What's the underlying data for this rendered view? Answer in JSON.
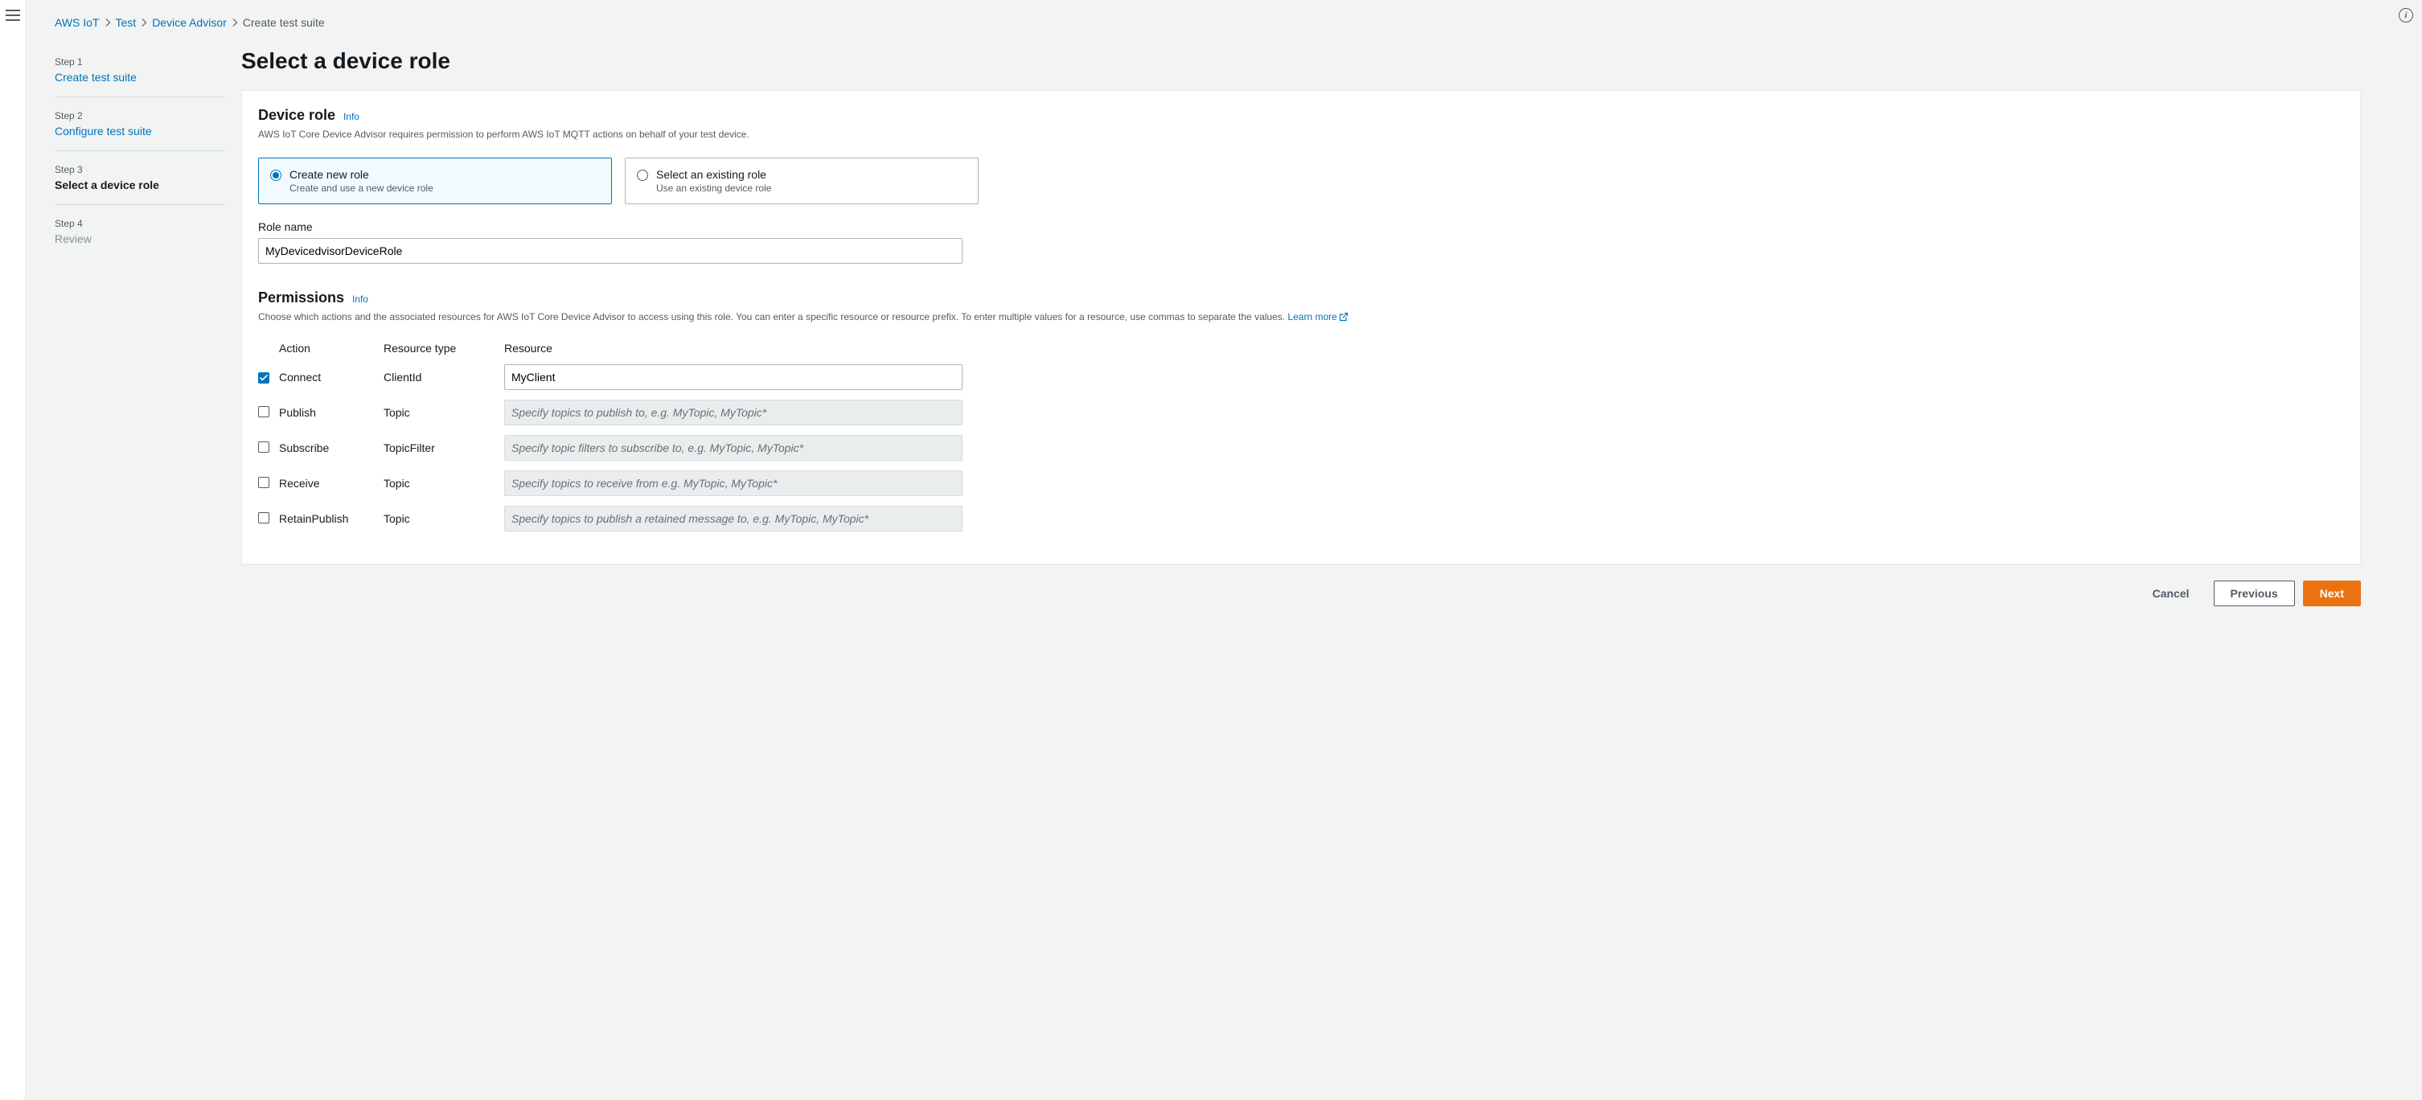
{
  "breadcrumbs": {
    "items": [
      {
        "label": "AWS IoT",
        "link": true
      },
      {
        "label": "Test",
        "link": true
      },
      {
        "label": "Device Advisor",
        "link": true
      },
      {
        "label": "Create test suite",
        "link": false
      }
    ]
  },
  "wizard": {
    "steps": [
      {
        "label": "Step 1",
        "title": "Create test suite",
        "state": "link"
      },
      {
        "label": "Step 2",
        "title": "Configure test suite",
        "state": "link"
      },
      {
        "label": "Step 3",
        "title": "Select a device role",
        "state": "active"
      },
      {
        "label": "Step 4",
        "title": "Review",
        "state": "disabled"
      }
    ]
  },
  "page": {
    "title": "Select a device role"
  },
  "deviceRole": {
    "heading": "Device role",
    "info": "Info",
    "description": "AWS IoT Core Device Advisor requires permission to perform AWS IoT MQTT actions on behalf of your test device.",
    "tiles": [
      {
        "title": "Create new role",
        "desc": "Create and use a new device role",
        "selected": true
      },
      {
        "title": "Select an existing role",
        "desc": "Use an existing device role",
        "selected": false
      }
    ],
    "roleNameLabel": "Role name",
    "roleNameValue": "MyDevicedvisorDeviceRole"
  },
  "permissions": {
    "heading": "Permissions",
    "info": "Info",
    "description": "Choose which actions and the associated resources for AWS IoT Core Device Advisor to access using this role. You can enter a specific resource or resource prefix. To enter multiple values for a resource, use commas to separate the values. ",
    "learnMore": "Learn more",
    "columns": {
      "action": "Action",
      "resourceType": "Resource type",
      "resource": "Resource"
    },
    "rows": [
      {
        "checked": true,
        "action": "Connect",
        "resourceType": "ClientId",
        "value": "MyClient",
        "placeholder": "",
        "disabled": false
      },
      {
        "checked": false,
        "action": "Publish",
        "resourceType": "Topic",
        "value": "",
        "placeholder": "Specify topics to publish to, e.g. MyTopic, MyTopic*",
        "disabled": true
      },
      {
        "checked": false,
        "action": "Subscribe",
        "resourceType": "TopicFilter",
        "value": "",
        "placeholder": "Specify topic filters to subscribe to, e.g. MyTopic, MyTopic*",
        "disabled": true
      },
      {
        "checked": false,
        "action": "Receive",
        "resourceType": "Topic",
        "value": "",
        "placeholder": "Specify topics to receive from e.g. MyTopic, MyTopic*",
        "disabled": true
      },
      {
        "checked": false,
        "action": "RetainPublish",
        "resourceType": "Topic",
        "value": "",
        "placeholder": "Specify topics to publish a retained message to, e.g. MyTopic, MyTopic*",
        "disabled": true
      }
    ]
  },
  "footer": {
    "cancel": "Cancel",
    "previous": "Previous",
    "next": "Next"
  }
}
